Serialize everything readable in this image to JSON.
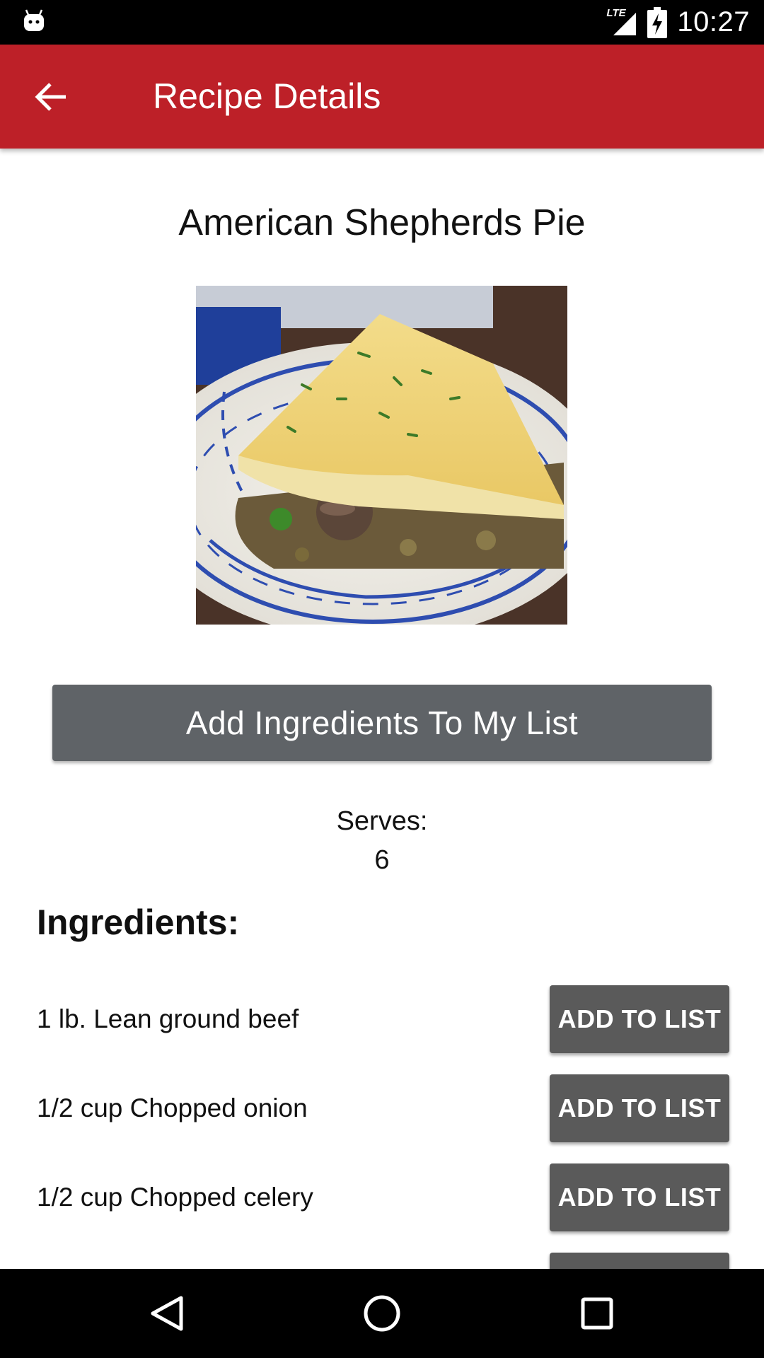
{
  "status_bar": {
    "time": "10:27",
    "network_label": "LTE",
    "icons": [
      "android-notification-icon",
      "lte-signal-icon",
      "battery-charging-icon"
    ]
  },
  "app_bar": {
    "title": "Recipe Details",
    "back_icon": "arrow-left-icon"
  },
  "recipe": {
    "title": "American Shepherds Pie",
    "add_all_label": "Add Ingredients To My List",
    "serves_label": "Serves:",
    "serves_value": "6"
  },
  "ingredients": {
    "heading": "Ingredients:",
    "button_label": "ADD TO LIST",
    "items": [
      {
        "text": "1 lb. Lean ground beef"
      },
      {
        "text": "1/2 cup Chopped onion"
      },
      {
        "text": "1/2 cup Chopped celery"
      },
      {
        "text": ""
      }
    ]
  },
  "nav_bar": {
    "buttons": [
      "back-triangle-icon",
      "home-circle-icon",
      "recents-square-icon"
    ]
  },
  "colors": {
    "app_bar": "#BD2028",
    "primary_button": "#5f6367",
    "row_button": "#5a5a5a"
  }
}
